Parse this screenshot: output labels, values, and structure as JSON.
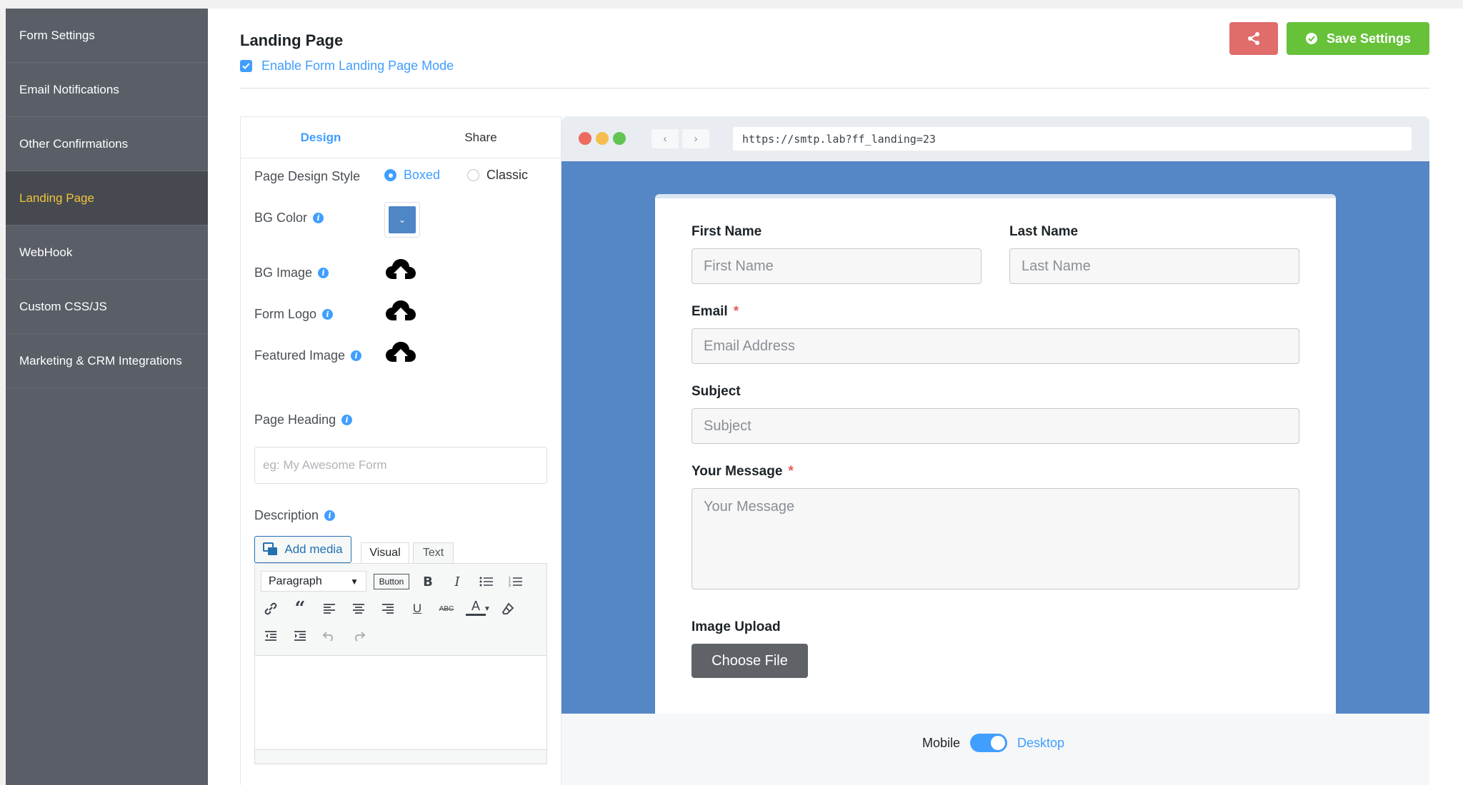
{
  "sidebar": {
    "items": [
      {
        "label": "Form Settings"
      },
      {
        "label": "Email Notifications"
      },
      {
        "label": "Other Confirmations"
      },
      {
        "label": "Landing Page",
        "active": true
      },
      {
        "label": "WebHook"
      },
      {
        "label": "Custom CSS/JS"
      },
      {
        "label": "Marketing & CRM Integrations"
      }
    ]
  },
  "header": {
    "title": "Landing Page",
    "enable_label": "Enable Form Landing Page Mode",
    "enable_checked": true,
    "share_icon": "share-icon",
    "save_label": "Save Settings",
    "save_icon": "check-circle-icon"
  },
  "settings": {
    "tabs": [
      {
        "label": "Design",
        "active": true
      },
      {
        "label": "Share"
      }
    ],
    "design_style": {
      "label": "Page Design Style",
      "options": [
        "Boxed",
        "Classic"
      ],
      "selected": "Boxed"
    },
    "bg_color": {
      "label": "BG Color",
      "value": "#4f86c6"
    },
    "bg_image": {
      "label": "BG Image"
    },
    "form_logo": {
      "label": "Form Logo"
    },
    "featured_image": {
      "label": "Featured Image"
    },
    "page_heading": {
      "label": "Page Heading",
      "placeholder": "eg: My Awesome Form",
      "value": ""
    },
    "description": {
      "label": "Description"
    },
    "editor": {
      "add_media": "Add media",
      "tab_visual": "Visual",
      "tab_text": "Text",
      "format_select": "Paragraph",
      "button_label": "Button"
    }
  },
  "preview": {
    "url": "https://smtp.lab?ff_landing=23",
    "form": {
      "first_name": {
        "label": "First Name",
        "placeholder": "First Name"
      },
      "last_name": {
        "label": "Last Name",
        "placeholder": "Last Name"
      },
      "email": {
        "label": "Email",
        "placeholder": "Email Address",
        "required": "*"
      },
      "subject": {
        "label": "Subject",
        "placeholder": "Subject"
      },
      "message": {
        "label": "Your Message",
        "placeholder": "Your Message",
        "required": "*"
      },
      "image_upload": {
        "label": "Image Upload",
        "button": "Choose File"
      }
    },
    "toggle": {
      "left": "Mobile",
      "right": "Desktop",
      "selected": "Desktop"
    }
  }
}
